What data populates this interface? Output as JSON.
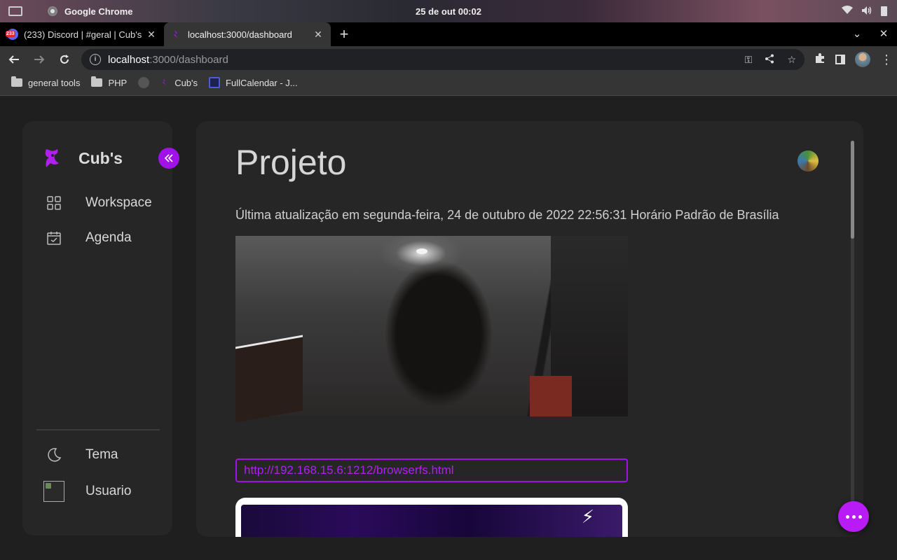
{
  "os": {
    "app_name": "Google Chrome",
    "clock": "25 de out  00:02"
  },
  "tabs": [
    {
      "title": "(233) Discord | #geral | Cub's",
      "badge": "233",
      "close": "✕"
    },
    {
      "title": "localhost:3000/dashboard",
      "close": "✕"
    }
  ],
  "toolbar": {
    "url_host": "localhost",
    "url_path": ":3000/dashboard"
  },
  "bookmarks": [
    {
      "label": "general tools",
      "icon": "folder-icon"
    },
    {
      "label": "PHP",
      "icon": "folder-icon"
    },
    {
      "label": "",
      "icon": "github-icon"
    },
    {
      "label": "Cub's",
      "icon": "cubs-logo-icon"
    },
    {
      "label": "FullCalendar - J...",
      "icon": "calendar-icon"
    }
  ],
  "sidebar": {
    "brand": "Cub's",
    "items": [
      {
        "label": "Workspace",
        "icon": "grid-icon"
      },
      {
        "label": "Agenda",
        "icon": "calendar-check-icon"
      }
    ],
    "bottom_items": [
      {
        "label": "Tema",
        "icon": "moon-icon"
      },
      {
        "label": "Usuario",
        "icon": "broken-image-icon"
      }
    ]
  },
  "main": {
    "title": "Projeto",
    "subtitle": "Última atualização em segunda-feira, 24 de outubro de 2022 22:56:31 Horário Padrão de Brasília",
    "link": "http://192.168.15.6:1212/browserfs.html"
  },
  "colors": {
    "accent": "#a012e8",
    "chat": "#b81bf5",
    "link": "#b020f0"
  }
}
